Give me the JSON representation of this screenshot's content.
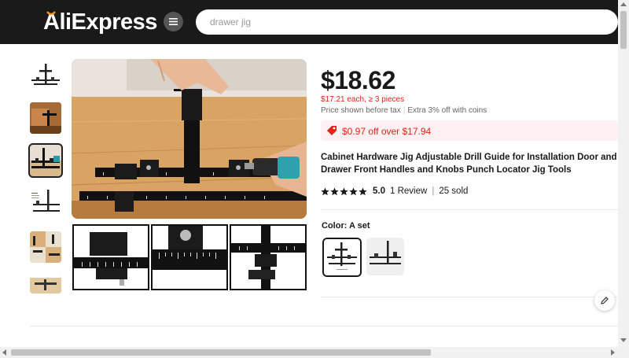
{
  "header": {
    "logo_text": "AliExpress",
    "search_placeholder": "drawer jig",
    "menu_icon": "hamburger-icon"
  },
  "gallery": {
    "thumbnail_count": 6,
    "selected_thumbnail_index": 2,
    "sub_image_count": 3
  },
  "product": {
    "price": "$18.62",
    "bulk_price": "$17.21 each, ≥ 3 pieces",
    "tax_note": "Price shown before tax",
    "coins_note": "Extra 3% off with coins",
    "coupon_text": "$0.97 off over $17.94",
    "title": "Cabinet Hardware Jig Adjustable Drill Guide for Installation Door and Drawer Front Handles and Knobs Punch Locator Jig Tools",
    "rating_value": "5.0",
    "rating_stars": 5,
    "review_count": "1 Review",
    "sold_count": "25 sold"
  },
  "variants": {
    "color_label": "Color: A set",
    "options_count": 2,
    "selected_index": 0
  },
  "colors": {
    "header_bg": "#1a1a1a",
    "price_red": "#e2231a",
    "coupon_bg": "#fff0f1"
  },
  "tools": {
    "edit_icon": "pencil-icon"
  }
}
